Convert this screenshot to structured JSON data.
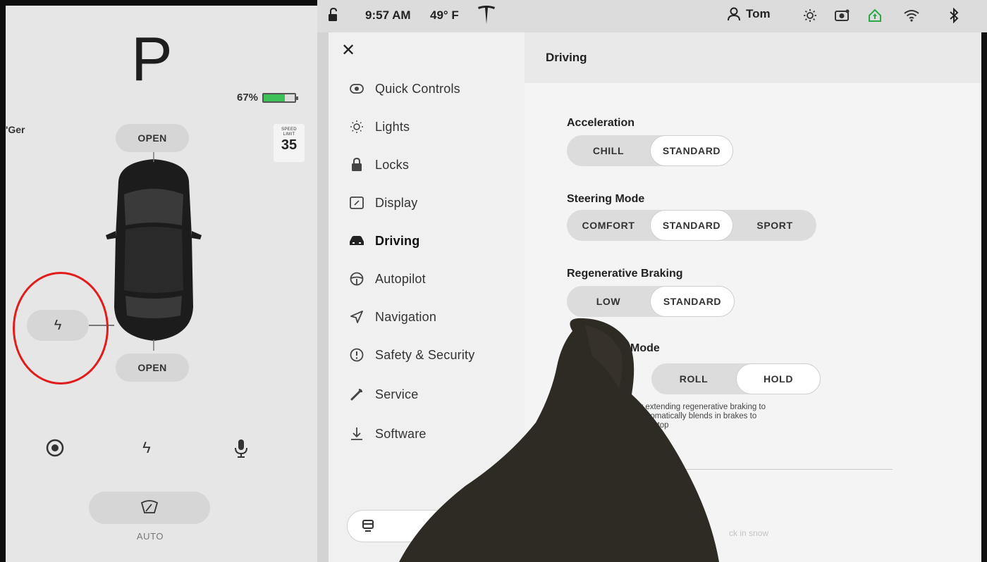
{
  "car_panel": {
    "gear": "P",
    "battery_percent_label": "67%",
    "battery_fraction": 0.67,
    "battery_color": "#3bc157",
    "nav_fragment": "'Ger",
    "speed_limit_caption": "SPEED\nLIMIT",
    "speed_limit_value": "35",
    "frunk_label": "OPEN",
    "trunk_label": "OPEN",
    "charge_port_icon": "lightning-icon",
    "bottom_icons": [
      "camera-icon",
      "lightning-icon",
      "microphone-icon"
    ],
    "wiper_icon": "wiper-icon",
    "wiper_label": "AUTO"
  },
  "status_bar": {
    "time": "9:57 AM",
    "temperature": "49° F",
    "user_name": "Tom",
    "icons": [
      "lock-open-icon",
      "tesla-logo",
      "user-icon",
      "sun-icon",
      "dashcam-icon",
      "home-icon",
      "wifi-icon",
      "bluetooth-icon"
    ]
  },
  "settings": {
    "menu": [
      {
        "label": "Quick Controls",
        "icon": "toggle-icon"
      },
      {
        "label": "Lights",
        "icon": "light-bulb-icon"
      },
      {
        "label": "Locks",
        "icon": "lock-icon"
      },
      {
        "label": "Display",
        "icon": "display-icon"
      },
      {
        "label": "Driving",
        "icon": "car-icon",
        "active": true
      },
      {
        "label": "Autopilot",
        "icon": "steering-wheel-icon"
      },
      {
        "label": "Navigation",
        "icon": "navigation-arrow-icon"
      },
      {
        "label": "Safety & Security",
        "icon": "alert-circle-icon"
      },
      {
        "label": "Service",
        "icon": "wrench-icon"
      },
      {
        "label": "Software",
        "icon": "download-icon"
      }
    ],
    "bottom_icon": "controls-icon"
  },
  "driving": {
    "title": "Driving",
    "acceleration": {
      "label": "Acceleration",
      "options": [
        "CHILL",
        "STANDARD"
      ],
      "selected": "STANDARD"
    },
    "steering": {
      "label": "Steering Mode",
      "options": [
        "COMFORT",
        "STANDARD",
        "SPORT"
      ],
      "selected": "STANDARD"
    },
    "regen": {
      "label": "Regenerative Braking",
      "options": [
        "LOW",
        "STANDARD"
      ],
      "selected": "STANDARD"
    },
    "stop": {
      "label_visible": "Mode",
      "options": [
        "ROLL",
        "HOLD"
      ],
      "selected": "HOLD",
      "description_lines": [
        "ge by extending regenerative braking to",
        "and automatically blends in brakes to",
        "icle at a stop"
      ]
    },
    "faded_text": "ck in snow"
  },
  "annotation_color": "#e11c1c"
}
